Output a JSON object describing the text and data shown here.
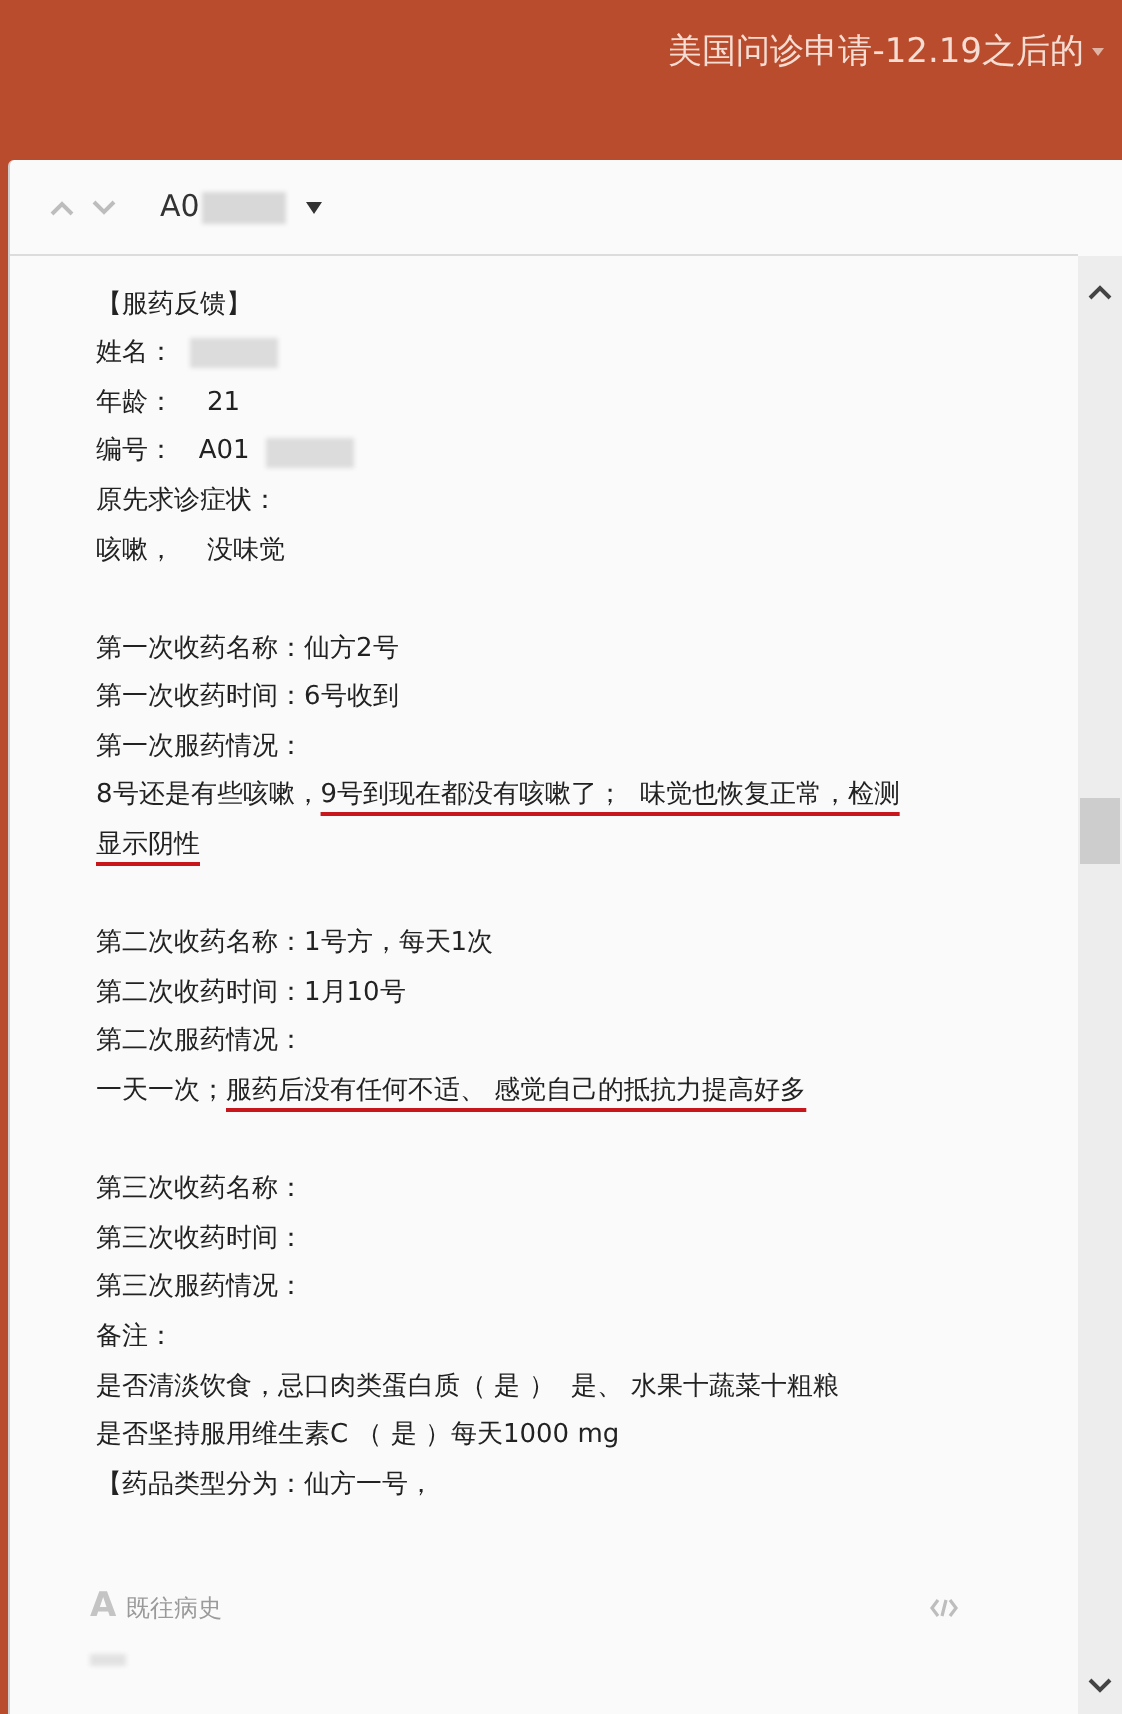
{
  "app_bar": {
    "title": "美国问诊申请-12.19之后的"
  },
  "record": {
    "prefix": "A0",
    "redacted": true
  },
  "lines": [
    {
      "kind": "text",
      "segments": [
        {
          "kind": "text",
          "text": "【服药反馈】",
          "underlined": false
        }
      ]
    },
    {
      "kind": "text",
      "segments": [
        {
          "kind": "text",
          "text": "姓名：",
          "underlined": false
        },
        {
          "kind": "redacted"
        }
      ]
    },
    {
      "kind": "text",
      "segments": [
        {
          "kind": "text",
          "text": "年龄：    21",
          "underlined": false
        }
      ]
    },
    {
      "kind": "text",
      "segments": [
        {
          "kind": "text",
          "text": "编号：   A01",
          "underlined": false
        },
        {
          "kind": "redacted"
        }
      ]
    },
    {
      "kind": "text",
      "segments": [
        {
          "kind": "text",
          "text": "原先求诊症状：",
          "underlined": false
        }
      ]
    },
    {
      "kind": "text",
      "segments": [
        {
          "kind": "text",
          "text": "咳嗽，    没味觉",
          "underlined": false
        }
      ]
    },
    {
      "kind": "blank"
    },
    {
      "kind": "text",
      "segments": [
        {
          "kind": "text",
          "text": "第一次收药名称：仙方2号",
          "underlined": false
        }
      ]
    },
    {
      "kind": "text",
      "segments": [
        {
          "kind": "text",
          "text": "第一次收药时间：6号收到",
          "underlined": false
        }
      ]
    },
    {
      "kind": "text",
      "segments": [
        {
          "kind": "text",
          "text": "第一次服药情况：",
          "underlined": false
        }
      ]
    },
    {
      "kind": "text",
      "segments": [
        {
          "kind": "text",
          "text": "8号还是有些咳嗽，",
          "underlined": false
        },
        {
          "kind": "text",
          "text": "9号到现在都没有咳嗽了；  味觉也恢复正常，检测",
          "underlined": true
        }
      ]
    },
    {
      "kind": "text",
      "segments": [
        {
          "kind": "text",
          "text": "显示阴性",
          "underlined": true
        }
      ]
    },
    {
      "kind": "blank"
    },
    {
      "kind": "text",
      "segments": [
        {
          "kind": "text",
          "text": "第二次收药名称：1号方，每天1次",
          "underlined": false
        }
      ]
    },
    {
      "kind": "text",
      "segments": [
        {
          "kind": "text",
          "text": "第二次收药时间：1月10号",
          "underlined": false
        }
      ]
    },
    {
      "kind": "text",
      "segments": [
        {
          "kind": "text",
          "text": "第二次服药情况：",
          "underlined": false
        }
      ]
    },
    {
      "kind": "text",
      "segments": [
        {
          "kind": "text",
          "text": "一天一次；",
          "underlined": false
        },
        {
          "kind": "text",
          "text": "服药后没有任何不适、 感觉自己的抵抗力提高好多",
          "underlined": true
        }
      ]
    },
    {
      "kind": "blank"
    },
    {
      "kind": "text",
      "segments": [
        {
          "kind": "text",
          "text": "第三次收药名称：",
          "underlined": false
        }
      ]
    },
    {
      "kind": "text",
      "segments": [
        {
          "kind": "text",
          "text": "第三次收药时间：",
          "underlined": false
        }
      ]
    },
    {
      "kind": "text",
      "segments": [
        {
          "kind": "text",
          "text": "第三次服药情况：",
          "underlined": false
        }
      ]
    },
    {
      "kind": "text",
      "segments": [
        {
          "kind": "text",
          "text": "备注：",
          "underlined": false
        }
      ]
    },
    {
      "kind": "text",
      "segments": [
        {
          "kind": "text",
          "text": "是否清淡饮食，忌口肉类蛋白质（ 是 ）  是、 水果十蔬菜十粗粮",
          "underlined": false
        }
      ]
    },
    {
      "kind": "text",
      "segments": [
        {
          "kind": "text",
          "text": "是否坚持服用维生素C （ 是 ）每天1000 mg",
          "underlined": false
        }
      ]
    },
    {
      "kind": "text",
      "segments": [
        {
          "kind": "text",
          "text": "【药品类型分为：仙方一号，",
          "underlined": false
        }
      ]
    }
  ],
  "footer": {
    "format_icon": "A",
    "field_label": "既往病史",
    "redacted": true
  }
}
